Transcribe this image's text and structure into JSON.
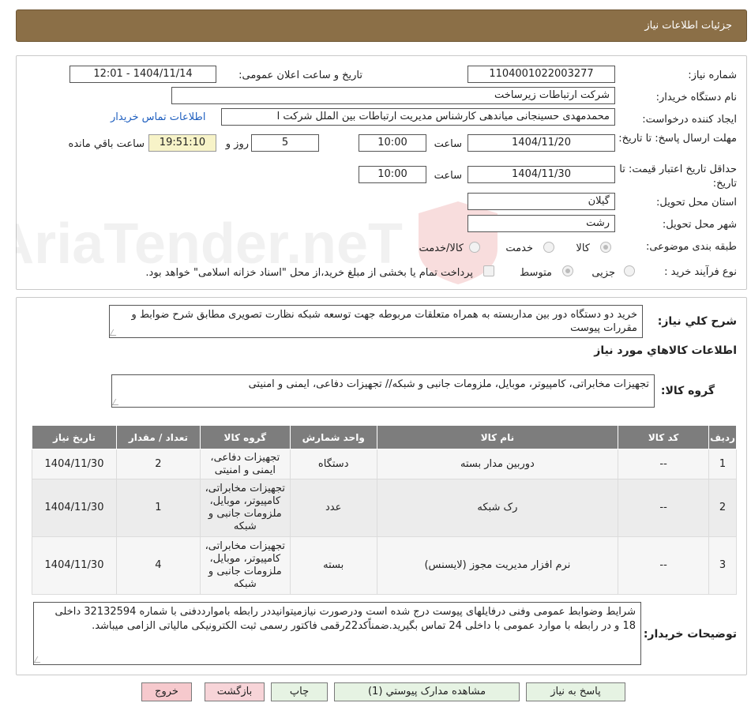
{
  "header": {
    "title": "جزئيات اطلاعات نياز"
  },
  "form": {
    "need_number_label": "شماره نیاز:",
    "need_number": "1104001022003277",
    "announce_label": "تاریخ و ساعت اعلان عمومی:",
    "announce_value": "1404/11/14 - 12:01",
    "buyer_label": "نام دستگاه خریدار:",
    "buyer_value": "شرکت ارتباطات زیرساخت",
    "creator_label": "ایجاد کننده درخواست:",
    "creator_value": "محمدمهدی حسینجانی میاندهی کارشناس مدیریت ارتباطات بین الملل شرکت ا",
    "contact_link": "اطلاعات تماس خریدار",
    "deadline_label": "مهلت ارسال پاسخ: تا تاریخ:",
    "deadline_date": "1404/11/20",
    "time_label": "ساعت",
    "deadline_time": "10:00",
    "days_value": "5",
    "days_label": "روز و",
    "remaining_time": "19:51:10",
    "remaining_label": "ساعت باقي مانده",
    "validity_label": "حداقل تاریخ اعتبار قیمت: تا تاریخ:",
    "validity_date": "1404/11/30",
    "validity_time": "10:00",
    "province_label": "استان محل تحویل:",
    "province_value": "گیلان",
    "city_label": "شهر محل تحویل:",
    "city_value": "رشت",
    "category_label": "طبقه بندی موضوعی:",
    "category_options": [
      "کالا",
      "خدمت",
      "کالا/خدمت"
    ],
    "process_label": "نوع فرآیند خرید :",
    "process_options": [
      "جزیی",
      "متوسط"
    ],
    "payment_note": "پرداخت تمام یا بخشی از مبلغ خرید،از محل \"اسناد خزانه اسلامی\" خواهد بود."
  },
  "description": {
    "label": "شرح کلي نياز:",
    "text": "خرید دو دستگاه دور بین مداربسته به همراه متعلقات مربوطه جهت توسعه شبکه نظارت تصویری  مطابق شرح ضوابط و مقررات پیوست"
  },
  "goods_section": {
    "title": "اطلاعات کالاهاي مورد نياز",
    "group_label": "گروه کالا:",
    "group_value": "تجهیزات مخابراتی، کامپیوتر، موبایل، ملزومات جانبی و شبکه// تجهیزات دفاعی، ایمنی و امنیتی"
  },
  "table": {
    "headers": [
      "رديف",
      "کد کالا",
      "نام کالا",
      "واحد شمارش",
      "گروه کالا",
      "تعداد / مقدار",
      "تاريخ نياز"
    ],
    "rows": [
      {
        "row": "1",
        "code": "--",
        "name": "دوربین مدار بسته",
        "unit": "دستگاه",
        "group": "تجهیزات دفاعی، ایمنی و امنیتی",
        "qty": "2",
        "date": "1404/11/30"
      },
      {
        "row": "2",
        "code": "--",
        "name": "رک شبکه",
        "unit": "عدد",
        "group": "تجهیزات مخابراتی، کامپیوتر، موبایل، ملزومات جانبی و شبکه",
        "qty": "1",
        "date": "1404/11/30"
      },
      {
        "row": "3",
        "code": "--",
        "name": "نرم افزار مدیریت مجوز (لایسنس)",
        "unit": "بسته",
        "group": "تجهیزات مخابراتی، کامپیوتر، موبایل، ملزومات جانبی و شبکه",
        "qty": "4",
        "date": "1404/11/30"
      }
    ]
  },
  "buyer_notes": {
    "label": "توضیحات خریدار:",
    "text": "شرایط وضوابط عمومی وفنی درفایلهای پیوست درج شده است ودرصورت نیازمیتوانیددر رابطه باموارددفنی با  شماره 32132594 داخلی 18 و در رابطه با موارد عمومی با داخلی 24 تماس  بگیرید.ضمناًکد22رقمی فاکتور رسمی ثبت الکترونیکی مالیاتی الزامی میباشد."
  },
  "buttons": {
    "reply": "پاسخ به نیاز",
    "attachments": "مشاهده مدارک پیوستي (1)",
    "print": "چاپ",
    "back": "بازگشت",
    "exit": "خروج"
  },
  "watermark": {
    "text": "AriaTender.neT"
  },
  "colors": {
    "header_bg": "#8b6f47",
    "table_header": "#7d7d7d",
    "link": "#1f5fbf"
  }
}
